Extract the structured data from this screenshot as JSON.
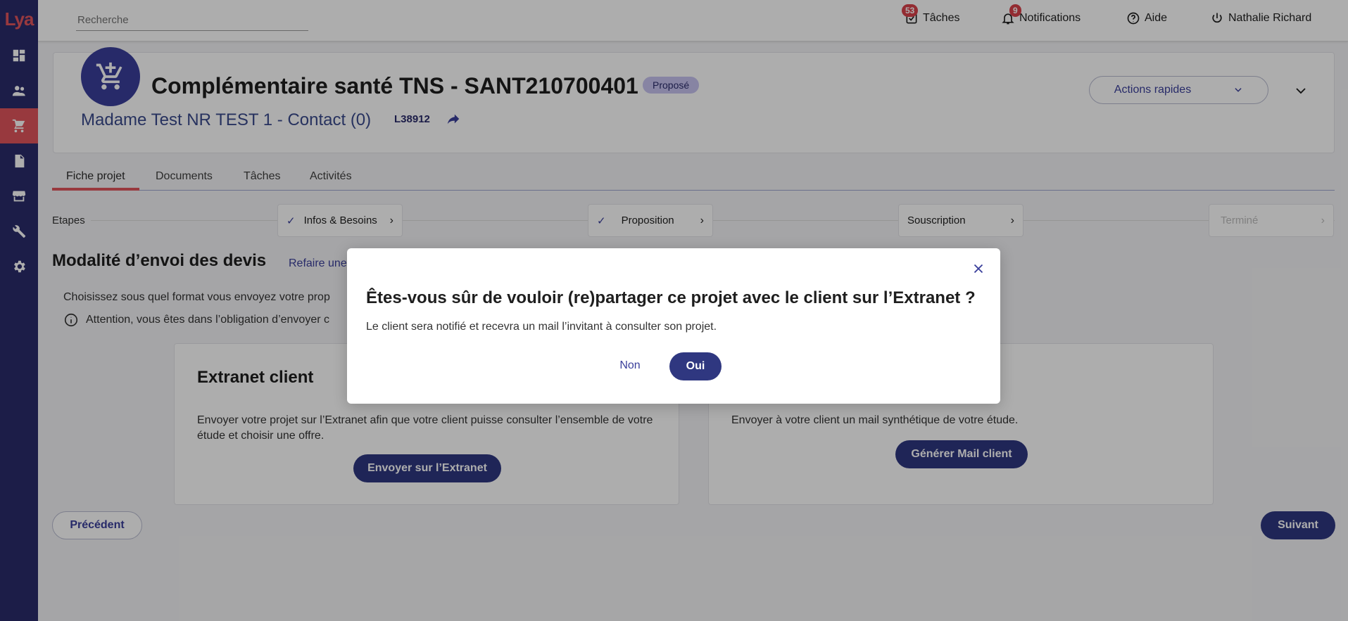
{
  "app": {
    "logo_text": "Lya"
  },
  "sidebar": {
    "items": [
      {
        "icon": "dashboard-icon"
      },
      {
        "icon": "people-icon"
      },
      {
        "icon": "cart-icon",
        "active": true
      },
      {
        "icon": "document-icon"
      },
      {
        "icon": "store-icon"
      },
      {
        "icon": "tools-icon"
      },
      {
        "icon": "settings-icon"
      }
    ]
  },
  "topbar": {
    "search_placeholder": "Recherche",
    "tasks": {
      "label": "Tâches",
      "badge": "53"
    },
    "notifications": {
      "label": "Notifications",
      "badge": "9"
    },
    "help": {
      "label": "Aide"
    },
    "user": {
      "label": "Nathalie Richard"
    }
  },
  "project": {
    "title": "Complémentaire santé TNS - SANT210700401",
    "status": "Proposé",
    "client": "Madame Test NR TEST 1 - Contact (0)",
    "code": "L38912",
    "actions_label": "Actions rapides"
  },
  "tabs": [
    "Fiche projet",
    "Documents",
    "Tâches",
    "Activités"
  ],
  "steps": {
    "label": "Etapes",
    "items": [
      "Infos & Besoins",
      "Proposition",
      "Souscription",
      "Terminé"
    ]
  },
  "main": {
    "section_title": "Modalité d’envoi des devis",
    "redo_link": "Refaire une",
    "choose_text": "Choisissez sous quel format vous envoyez votre prop",
    "warning_text": "Attention, vous êtes dans l’obligation d’envoyer c",
    "extranet_card": {
      "title": "Extranet client",
      "desc": "Envoyer votre projet sur l’Extranet afin que votre client puisse consulter l’ensemble de votre étude et choisir une offre.",
      "button": "Envoyer sur l’Extranet"
    },
    "mail_card": {
      "desc": "Envoyer à votre client un mail synthétique de votre étude.",
      "button": "Générer Mail client"
    },
    "prev_button": "Précédent",
    "next_button": "Suivant"
  },
  "modal": {
    "title": "Êtes-vous sûr de vouloir (re)partager ce projet avec le client sur l’Extranet ?",
    "text": "Le client sera notifié et recevra un mail l’invitant à consulter son projet.",
    "no_label": "Non",
    "yes_label": "Oui"
  },
  "colors": {
    "sidebar": "#2a2b6b",
    "accent": "#e0555c",
    "primary": "#2f3780",
    "badge": "#d9414b"
  }
}
